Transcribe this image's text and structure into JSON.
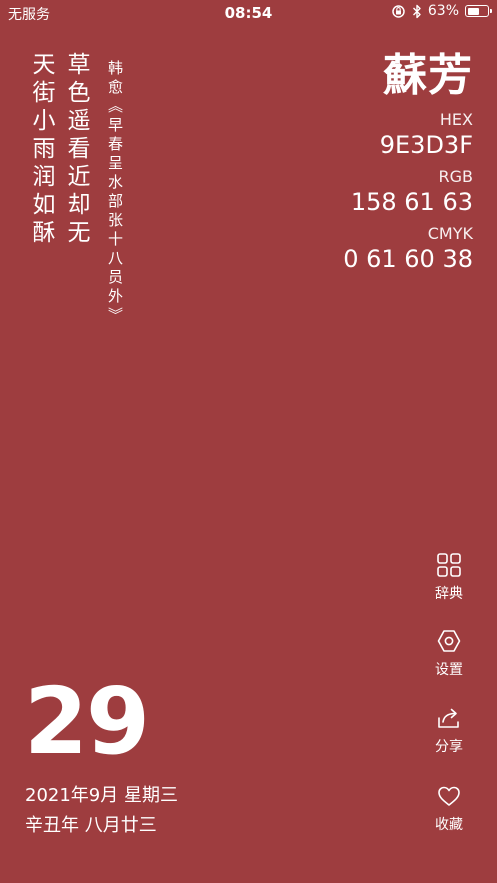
{
  "status_bar": {
    "carrier": "无服务",
    "time": "08:54",
    "battery_percent": "63%",
    "battery_level": 0.63,
    "icons": [
      "orientation-lock-icon",
      "bluetooth-icon",
      "battery-icon"
    ]
  },
  "poem": {
    "line1": "草色遥看近却无",
    "line2": "天街小雨润如酥",
    "source": "韩愈《早春呈水部张十八员外》"
  },
  "color": {
    "name": "蘇芳",
    "hex_label": "HEX",
    "hex_value": "9E3D3F",
    "rgb_label": "RGB",
    "rgb_value": "158 61 63",
    "cmyk_label": "CMYK",
    "cmyk_value": "0 61 60 38",
    "background": "#9E3D3F"
  },
  "actions": {
    "dictionary": "辞典",
    "settings": "设置",
    "share": "分享",
    "favorite": "收藏"
  },
  "date": {
    "day": "29",
    "full": "2021年9月  星期三",
    "lunar": "辛丑年  八月廿三"
  }
}
